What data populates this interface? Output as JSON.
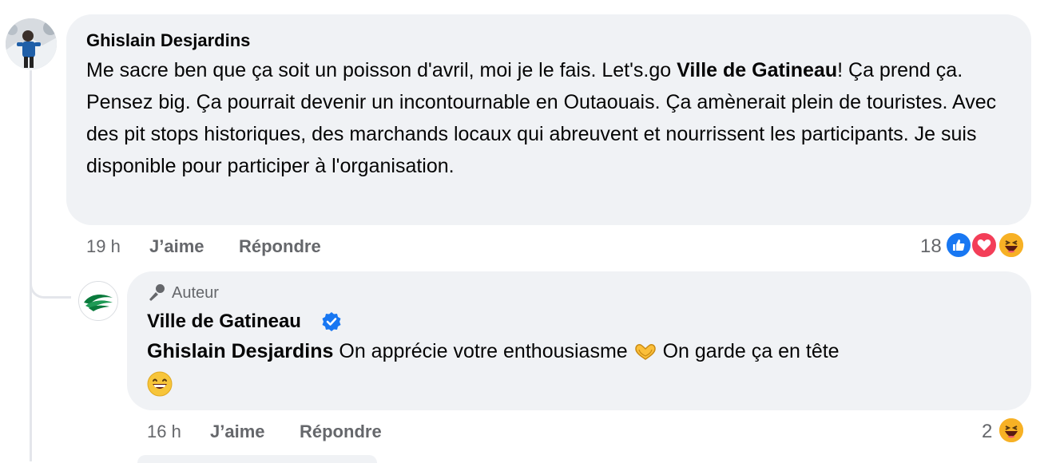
{
  "comment1": {
    "author": "Ghislain Desjardins",
    "text_part1": "Me sacre ben que ça soit un poisson d'avril, moi je le fais. Let's.go ",
    "mention": "Ville de Gatineau",
    "text_part2": "! Ça prend ça. Pensez big. Ça pourrait devenir un incontournable en Outaouais. Ça amènerait plein de touristes. Avec des pit stops historiques, des marchands locaux qui abreuvent et nourrissent les participants. Je suis disponible pour participer à l'organisation.",
    "time": "19 h",
    "like_label": "J’aime",
    "reply_label": "Répondre",
    "reaction_count": "18",
    "reactions": [
      "like-icon",
      "love-icon",
      "haha-icon"
    ]
  },
  "comment2": {
    "badge_label": "Auteur",
    "author": "Ville de Gatineau",
    "verified_icon": "verified-badge-icon",
    "mention": "Ghislain Desjardins",
    "text_part1": " On apprécie votre enthousiasme ",
    "text_part2": " On garde ça en tête",
    "time": "16 h",
    "like_label": "J’aime",
    "reply_label": "Répondre",
    "reaction_count": "2",
    "reactions": [
      "haha-icon"
    ]
  },
  "colors": {
    "bubble": "#f0f2f5",
    "secondary_text": "#65676b",
    "like_blue": "#1877f2",
    "love_red": "#f33e58",
    "haha_yellow": "#f7b125",
    "logo_green": "#0a7a3c"
  }
}
